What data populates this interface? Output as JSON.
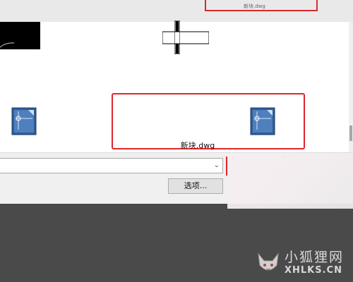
{
  "files": [
    {
      "name": "",
      "icon": "dwg-file-icon"
    },
    {
      "name": "新块.dwg",
      "icon": "dwg-file-icon"
    }
  ],
  "selected_file": "新块.dwg",
  "buttons": {
    "options": "选项..."
  },
  "combo": {
    "value": "",
    "arrow": "chevron-down-icon"
  },
  "top_strip": {
    "text": "新块.dwg"
  },
  "watermark": {
    "cn": "小狐狸网",
    "en": "XHLKS.CN"
  },
  "colors": {
    "highlight": "#e0262b",
    "background": "#4a4a4a"
  }
}
